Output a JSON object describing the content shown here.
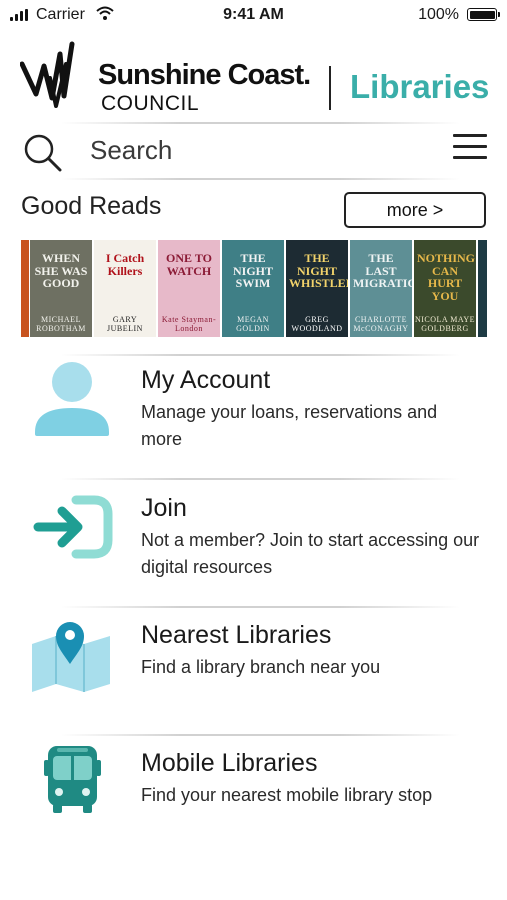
{
  "status_bar": {
    "carrier": "Carrier",
    "time": "9:41 AM",
    "battery": "100%"
  },
  "header": {
    "council_name": "Sunshine Coast.",
    "council_word": "COUNCIL",
    "app_name": "Libraries"
  },
  "search": {
    "placeholder": "Search"
  },
  "good_reads": {
    "title": "Good Reads",
    "more_label": "more >",
    "books": [
      {
        "title": "",
        "author": ""
      },
      {
        "title": "WHEN SHE WAS GOOD",
        "author": "MICHAEL ROBOTHAM"
      },
      {
        "title": "I Catch Killers",
        "author": "GARY JUBELIN"
      },
      {
        "title": "ONE TO WATCH",
        "author": "Kate Stayman-London"
      },
      {
        "title": "THE NIGHT SWIM",
        "author": "MEGAN GOLDIN"
      },
      {
        "title": "THE NIGHT WHISTLER",
        "author": "GREG WOODLAND"
      },
      {
        "title": "THE LAST MIGRATION",
        "author": "CHARLOTTE McCONAGHY"
      },
      {
        "title": "NOTHING CAN HURT YOU",
        "author": "NICOLA MAYE GOLDBERG"
      },
      {
        "title": "",
        "author": ""
      }
    ]
  },
  "menu": [
    {
      "title": "My Account",
      "description": "Manage your loans, reservations and more",
      "icon": "account-icon"
    },
    {
      "title": "Join",
      "description": "Not a member? Join to start accessing our digital resources",
      "icon": "join-icon"
    },
    {
      "title": "Nearest Libraries",
      "description": "Find a library branch near you",
      "icon": "map-pin-icon"
    },
    {
      "title": "Mobile Libraries",
      "description": "Find your nearest mobile library stop",
      "icon": "bus-icon"
    }
  ],
  "colors": {
    "accent": "#3aaea9",
    "icon_light": "#7fd0e3",
    "icon_dark": "#1f8a83"
  }
}
